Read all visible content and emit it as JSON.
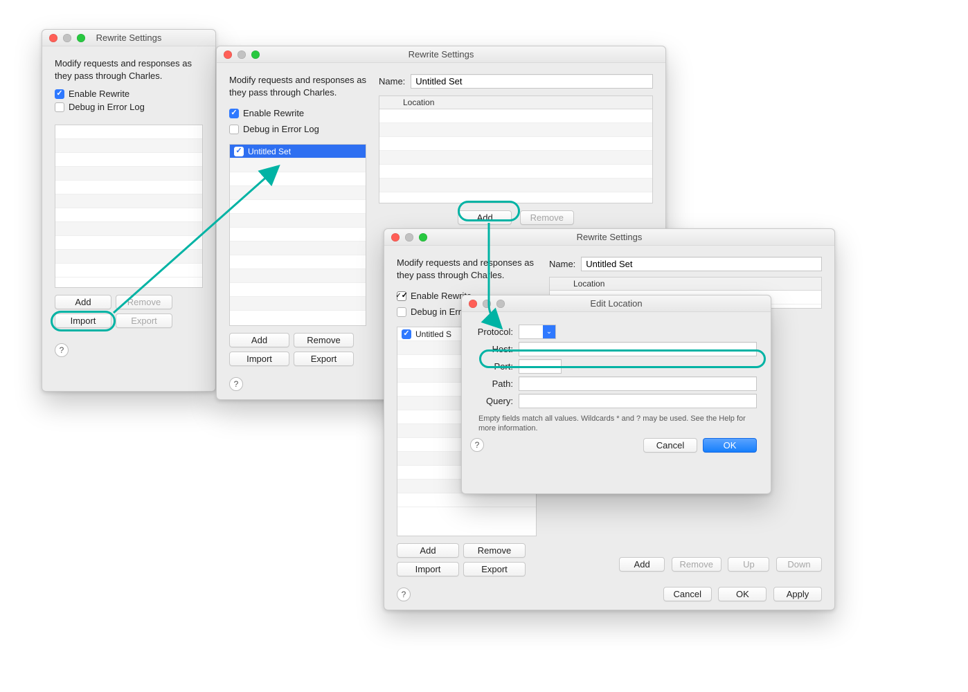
{
  "common": {
    "window_title": "Rewrite Settings",
    "intro": "Modify requests and responses as they pass through Charles.",
    "enable_label": "Enable Rewrite",
    "debug_label": "Debug in Error Log",
    "add": "Add",
    "remove": "Remove",
    "import": "Import",
    "export": "Export",
    "help": "?",
    "cancel": "Cancel",
    "ok": "OK",
    "apply": "Apply",
    "up": "Up",
    "down": "Down",
    "name_label": "Name:",
    "location_header": "Location"
  },
  "win1": {
    "enable_checked": true,
    "debug_checked": false
  },
  "win2": {
    "enable_checked": true,
    "debug_checked": false,
    "name_value": "Untitled Set",
    "set_label": "Untitled Set",
    "set_checked": true
  },
  "win3": {
    "enable_checked": true,
    "debug_checked": false,
    "name_value": "Untitled Set",
    "set_label": "Untitled S",
    "set_checked": true
  },
  "edit_location": {
    "title": "Edit Location",
    "protocol_label": "Protocol:",
    "host_label": "Host:",
    "port_label": "Port:",
    "path_label": "Path:",
    "query_label": "Query:",
    "protocol_value": "",
    "host_value": "",
    "port_value": "",
    "path_value": "",
    "query_value": "",
    "hint": "Empty fields match all values. Wildcards * and ? may be used. See the Help for more information."
  }
}
